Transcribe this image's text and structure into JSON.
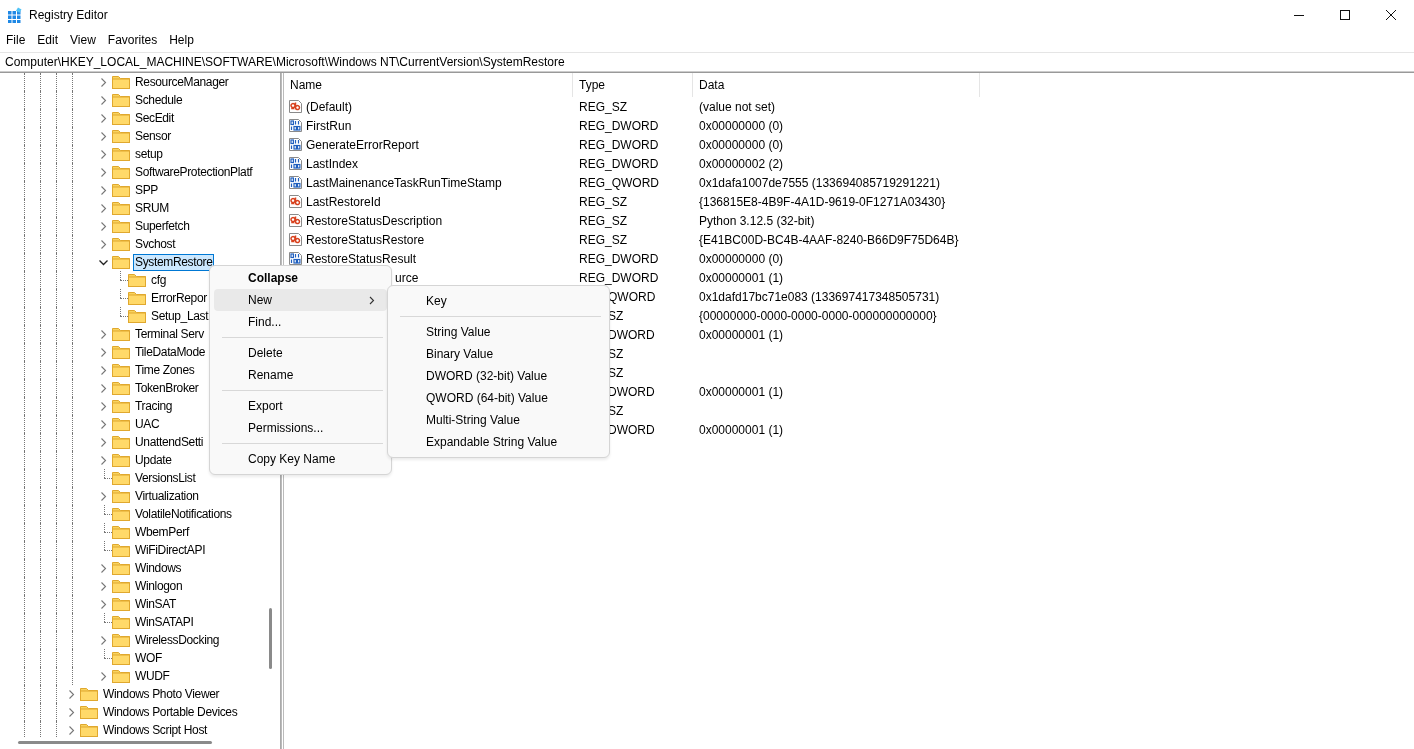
{
  "window": {
    "title": "Registry Editor"
  },
  "menu_bar": [
    "File",
    "Edit",
    "View",
    "Favorites",
    "Help"
  ],
  "address": "Computer\\HKEY_LOCAL_MACHINE\\SOFTWARE\\Microsoft\\Windows NT\\CurrentVersion\\SystemRestore",
  "tree": {
    "items": [
      {
        "children": [
          {
            "children": [
              {
                "children": [
                  {
                    "children": [
                      {
                        "children": [
                          {
                            "children": [
                              {
                                "label": "ResourceManager",
                                "expanded": false,
                                "selected": false
                              },
                              {
                                "label": "Schedule",
                                "expanded": false,
                                "selected": false
                              },
                              {
                                "label": "SecEdit",
                                "expanded": false,
                                "selected": false
                              },
                              {
                                "label": "Sensor",
                                "expanded": false,
                                "selected": false
                              },
                              {
                                "label": "setup",
                                "expanded": false,
                                "selected": false
                              },
                              {
                                "label": "SoftwareProtectionPlatf",
                                "expanded": false,
                                "selected": false
                              },
                              {
                                "label": "SPP",
                                "expanded": false,
                                "selected": false
                              },
                              {
                                "label": "SRUM",
                                "expanded": false,
                                "selected": false
                              },
                              {
                                "label": "Superfetch",
                                "expanded": false,
                                "selected": false
                              },
                              {
                                "label": "Svchost",
                                "expanded": false,
                                "selected": false
                              },
                              {
                                "label": "SystemRestore",
                                "expanded": true,
                                "selected": true,
                                "children": [
                                  {
                                    "label": "cfg",
                                    "selected": false
                                  },
                                  {
                                    "label": "ErrorRepor",
                                    "selected": false
                                  },
                                  {
                                    "label": "Setup_Last",
                                    "selected": false
                                  }
                                ]
                              },
                              {
                                "label": "Terminal Serv",
                                "expanded": false,
                                "selected": false
                              },
                              {
                                "label": "TileDataMode",
                                "expanded": false,
                                "selected": false
                              },
                              {
                                "label": "Time Zones",
                                "expanded": false,
                                "selected": false
                              },
                              {
                                "label": "TokenBroker",
                                "expanded": false,
                                "selected": false
                              },
                              {
                                "label": "Tracing",
                                "expanded": false,
                                "selected": false
                              },
                              {
                                "label": "UAC",
                                "expanded": false,
                                "selected": false
                              },
                              {
                                "label": "UnattendSetti",
                                "expanded": false,
                                "selected": false
                              },
                              {
                                "label": "Update",
                                "expanded": false,
                                "selected": false
                              },
                              {
                                "label": "VersionsList",
                                "selected": false
                              },
                              {
                                "label": "Virtualization",
                                "expanded": false,
                                "selected": false
                              },
                              {
                                "label": "VolatileNotifications",
                                "selected": false
                              },
                              {
                                "label": "WbemPerf",
                                "selected": false
                              },
                              {
                                "label": "WiFiDirectAPI",
                                "selected": false
                              },
                              {
                                "label": "Windows",
                                "expanded": false,
                                "selected": false
                              },
                              {
                                "label": "Winlogon",
                                "expanded": false,
                                "selected": false
                              },
                              {
                                "label": "WinSAT",
                                "expanded": false,
                                "selected": false
                              },
                              {
                                "label": "WinSATAPI",
                                "selected": false
                              },
                              {
                                "label": "WirelessDocking",
                                "expanded": false,
                                "selected": false
                              },
                              {
                                "label": "WOF",
                                "selected": false
                              },
                              {
                                "label": "WUDF",
                                "expanded": false,
                                "selected": false
                              }
                            ]
                          }
                        ]
                      },
                      {
                        "label": "Windows Photo Viewer",
                        "expanded": false,
                        "selected": false
                      },
                      {
                        "label": "Windows Portable Devices",
                        "expanded": false,
                        "selected": false
                      },
                      {
                        "label": "Windows Script Host",
                        "expanded": false,
                        "selected": false
                      }
                    ]
                  }
                ]
              }
            ]
          }
        ]
      }
    ]
  },
  "table": {
    "columns": [
      "Name",
      "Type",
      "Data"
    ],
    "rows": [
      {
        "kind": "string",
        "name": "(Default)",
        "type": "REG_SZ",
        "data": "(value not set)"
      },
      {
        "kind": "binary",
        "name": "FirstRun",
        "type": "REG_DWORD",
        "data": "0x00000000 (0)"
      },
      {
        "kind": "binary",
        "name": "GenerateErrorReport",
        "type": "REG_DWORD",
        "data": "0x00000000 (0)"
      },
      {
        "kind": "binary",
        "name": "LastIndex",
        "type": "REG_DWORD",
        "data": "0x00000002 (2)"
      },
      {
        "kind": "binary",
        "name": "LastMainenanceTaskRunTimeStamp",
        "type": "REG_QWORD",
        "data": "0x1dafa1007de7555 (133694085719291221)"
      },
      {
        "kind": "string",
        "name": "LastRestoreId",
        "type": "REG_SZ",
        "data": "{136815E8-4B9F-4A1D-9619-0F1271A03430}"
      },
      {
        "kind": "string",
        "name": "RestoreStatusDescription",
        "type": "REG_SZ",
        "data": "Python 3.12.5 (32-bit)"
      },
      {
        "kind": "string",
        "name": "RestoreStatusRestore",
        "type": "REG_SZ",
        "data": "{E41BC00D-BC4B-4AAF-8240-B66D9F75D64B}"
      },
      {
        "kind": "binary",
        "name": "RestoreStatusResult",
        "type": "REG_DWORD",
        "data": "0x00000000 (0)"
      },
      {
        "name": "urce",
        "type": "REG_DWORD",
        "data": "0x00000001 (1)"
      },
      {
        "type": "QWORD",
        "data": "0x1dafd17bc71e083 (133697417348505731)"
      },
      {
        "type": "SZ",
        "data": "{00000000-0000-0000-0000-000000000000}"
      },
      {
        "type": "DWORD",
        "data": "0x00000001 (1)"
      },
      {
        "type": "SZ"
      },
      {
        "type": "SZ"
      },
      {
        "type": "DWORD",
        "data": "0x00000001 (1)"
      },
      {
        "type": "SZ"
      },
      {
        "type": "DWORD",
        "data": "0x00000001 (1)"
      }
    ]
  },
  "context_menu": {
    "items": [
      {
        "kind": "item",
        "label": "Collapse",
        "default": true,
        "selected": false
      },
      {
        "kind": "submenu",
        "label": "New",
        "default": false,
        "selected": true
      },
      {
        "kind": "item",
        "label": "Find...",
        "default": false,
        "selected": false
      },
      {
        "kind": "separator"
      },
      {
        "kind": "item",
        "label": "Delete",
        "default": false,
        "selected": false
      },
      {
        "kind": "item",
        "label": "Rename",
        "default": false,
        "selected": false
      },
      {
        "kind": "separator"
      },
      {
        "kind": "item",
        "label": "Export",
        "default": false,
        "selected": false
      },
      {
        "kind": "item",
        "label": "Permissions...",
        "default": false,
        "selected": false
      },
      {
        "kind": "separator"
      },
      {
        "kind": "item",
        "label": "Copy Key Name",
        "default": false,
        "selected": false
      }
    ]
  },
  "submenu": {
    "items": [
      {
        "kind": "item",
        "label": "Key"
      },
      {
        "kind": "separator"
      },
      {
        "kind": "item",
        "label": "String Value"
      },
      {
        "kind": "item",
        "label": "Binary Value"
      },
      {
        "kind": "item",
        "label": "DWORD (32-bit) Value"
      },
      {
        "kind": "item",
        "label": "QWORD (64-bit) Value"
      },
      {
        "kind": "item",
        "label": "Multi-String Value"
      },
      {
        "kind": "item",
        "label": "Expandable String Value"
      }
    ]
  }
}
